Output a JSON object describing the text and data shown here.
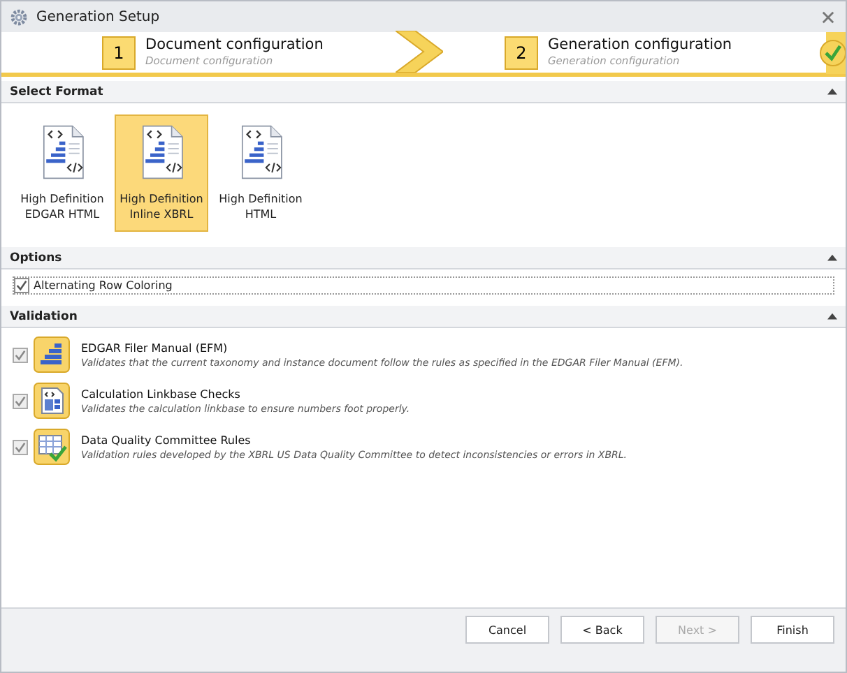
{
  "window": {
    "title": "Generation Setup"
  },
  "steps": [
    {
      "number": "1",
      "title": "Document configuration",
      "subtitle": "Document configuration",
      "completed": false
    },
    {
      "number": "2",
      "title": "Generation configuration",
      "subtitle": "Generation configuration",
      "completed": true
    }
  ],
  "format_section": {
    "title": "Select Format",
    "expanded": true,
    "formats": [
      {
        "label": "High Definition EDGAR HTML",
        "selected": false
      },
      {
        "label": "High Definition Inline XBRL",
        "selected": true
      },
      {
        "label": "High Definition HTML",
        "selected": false
      }
    ]
  },
  "options_section": {
    "title": "Options",
    "expanded": true,
    "options": [
      {
        "label": "Alternating Row Coloring",
        "checked": true
      }
    ]
  },
  "validation_section": {
    "title": "Validation",
    "expanded": true,
    "rules": [
      {
        "kind": "stack",
        "title": "EDGAR Filer Manual (EFM)",
        "description": "Validates that the current taxonomy and instance document follow the rules as specified in the EDGAR Filer Manual (EFM).",
        "checked": true
      },
      {
        "kind": "calc",
        "title": "Calculation Linkbase Checks",
        "description": "Validates the calculation linkbase to ensure numbers foot properly.",
        "checked": true
      },
      {
        "kind": "table",
        "title": "Data Quality Committee Rules",
        "description": "Validation rules developed by the XBRL US Data Quality Committee to detect inconsistencies or errors in XBRL.",
        "checked": true
      }
    ]
  },
  "buttons": [
    {
      "label": "Cancel",
      "disabled": false
    },
    {
      "label": "< Back",
      "disabled": false
    },
    {
      "label": "Next >",
      "disabled": true
    },
    {
      "label": "Finish",
      "disabled": false
    }
  ]
}
